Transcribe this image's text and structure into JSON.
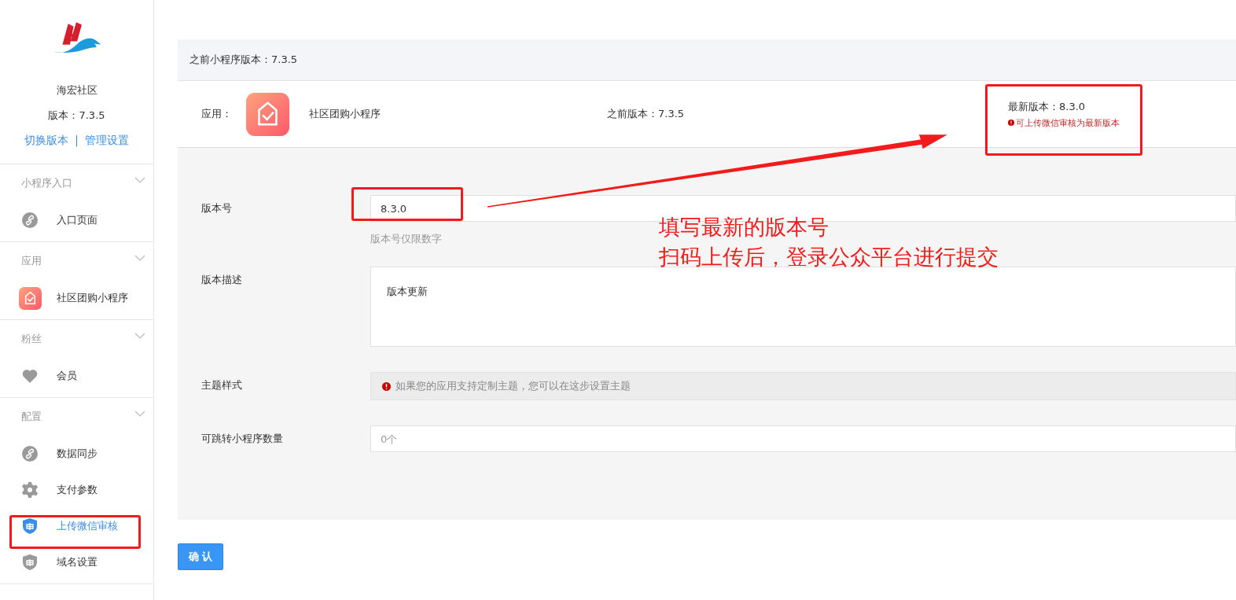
{
  "sidebar": {
    "brand": "海宏社区",
    "version": "版本：7.3.5",
    "links": [
      "切换版本",
      "管理设置"
    ],
    "separator": "|",
    "groups": [
      {
        "title": "小程序入口",
        "items": [
          {
            "label": "入口页面",
            "kind": "link",
            "selected": false
          }
        ]
      },
      {
        "title": "应用",
        "items": [
          {
            "label": "社区团购小程序",
            "kind": "app",
            "selected": false
          }
        ]
      },
      {
        "title": "粉丝",
        "items": [
          {
            "label": "会员",
            "kind": "heart",
            "selected": false
          }
        ]
      },
      {
        "title": "配置",
        "items": [
          {
            "label": "数据同步",
            "kind": "link",
            "selected": false
          },
          {
            "label": "支付参数",
            "kind": "gear",
            "selected": false
          },
          {
            "label": "上传微信审核",
            "kind": "shield",
            "selected": true
          },
          {
            "label": "域名设置",
            "kind": "shield",
            "selected": false
          }
        ]
      }
    ]
  },
  "header_bar": {
    "text": "之前小程序版本：7.3.5"
  },
  "app_info": {
    "label": "应用：",
    "app_name": "社区团购小程序",
    "previous_version": "之前版本：7.3.5",
    "latest_version": "最新版本：8.3.0",
    "latest_note": "可上传微信审核为最新版本"
  },
  "form": {
    "fields": [
      {
        "kind": "input",
        "label": "版本号",
        "value": "8.3.0",
        "hint": "版本号仅限数字"
      },
      {
        "kind": "textarea",
        "label": "版本描述",
        "value": "版本更新"
      },
      {
        "kind": "notice",
        "label": "主题样式",
        "text": "如果您的应用支持定制主题，您可以在这步设置主题"
      },
      {
        "kind": "input",
        "label": "可跳转小程序数量",
        "placeholder": "0个"
      }
    ]
  },
  "confirm_button": "确 认",
  "annotation": {
    "lines": [
      "填写最新的版本号",
      "扫码上传后，登录公众平台进行提交"
    ]
  }
}
